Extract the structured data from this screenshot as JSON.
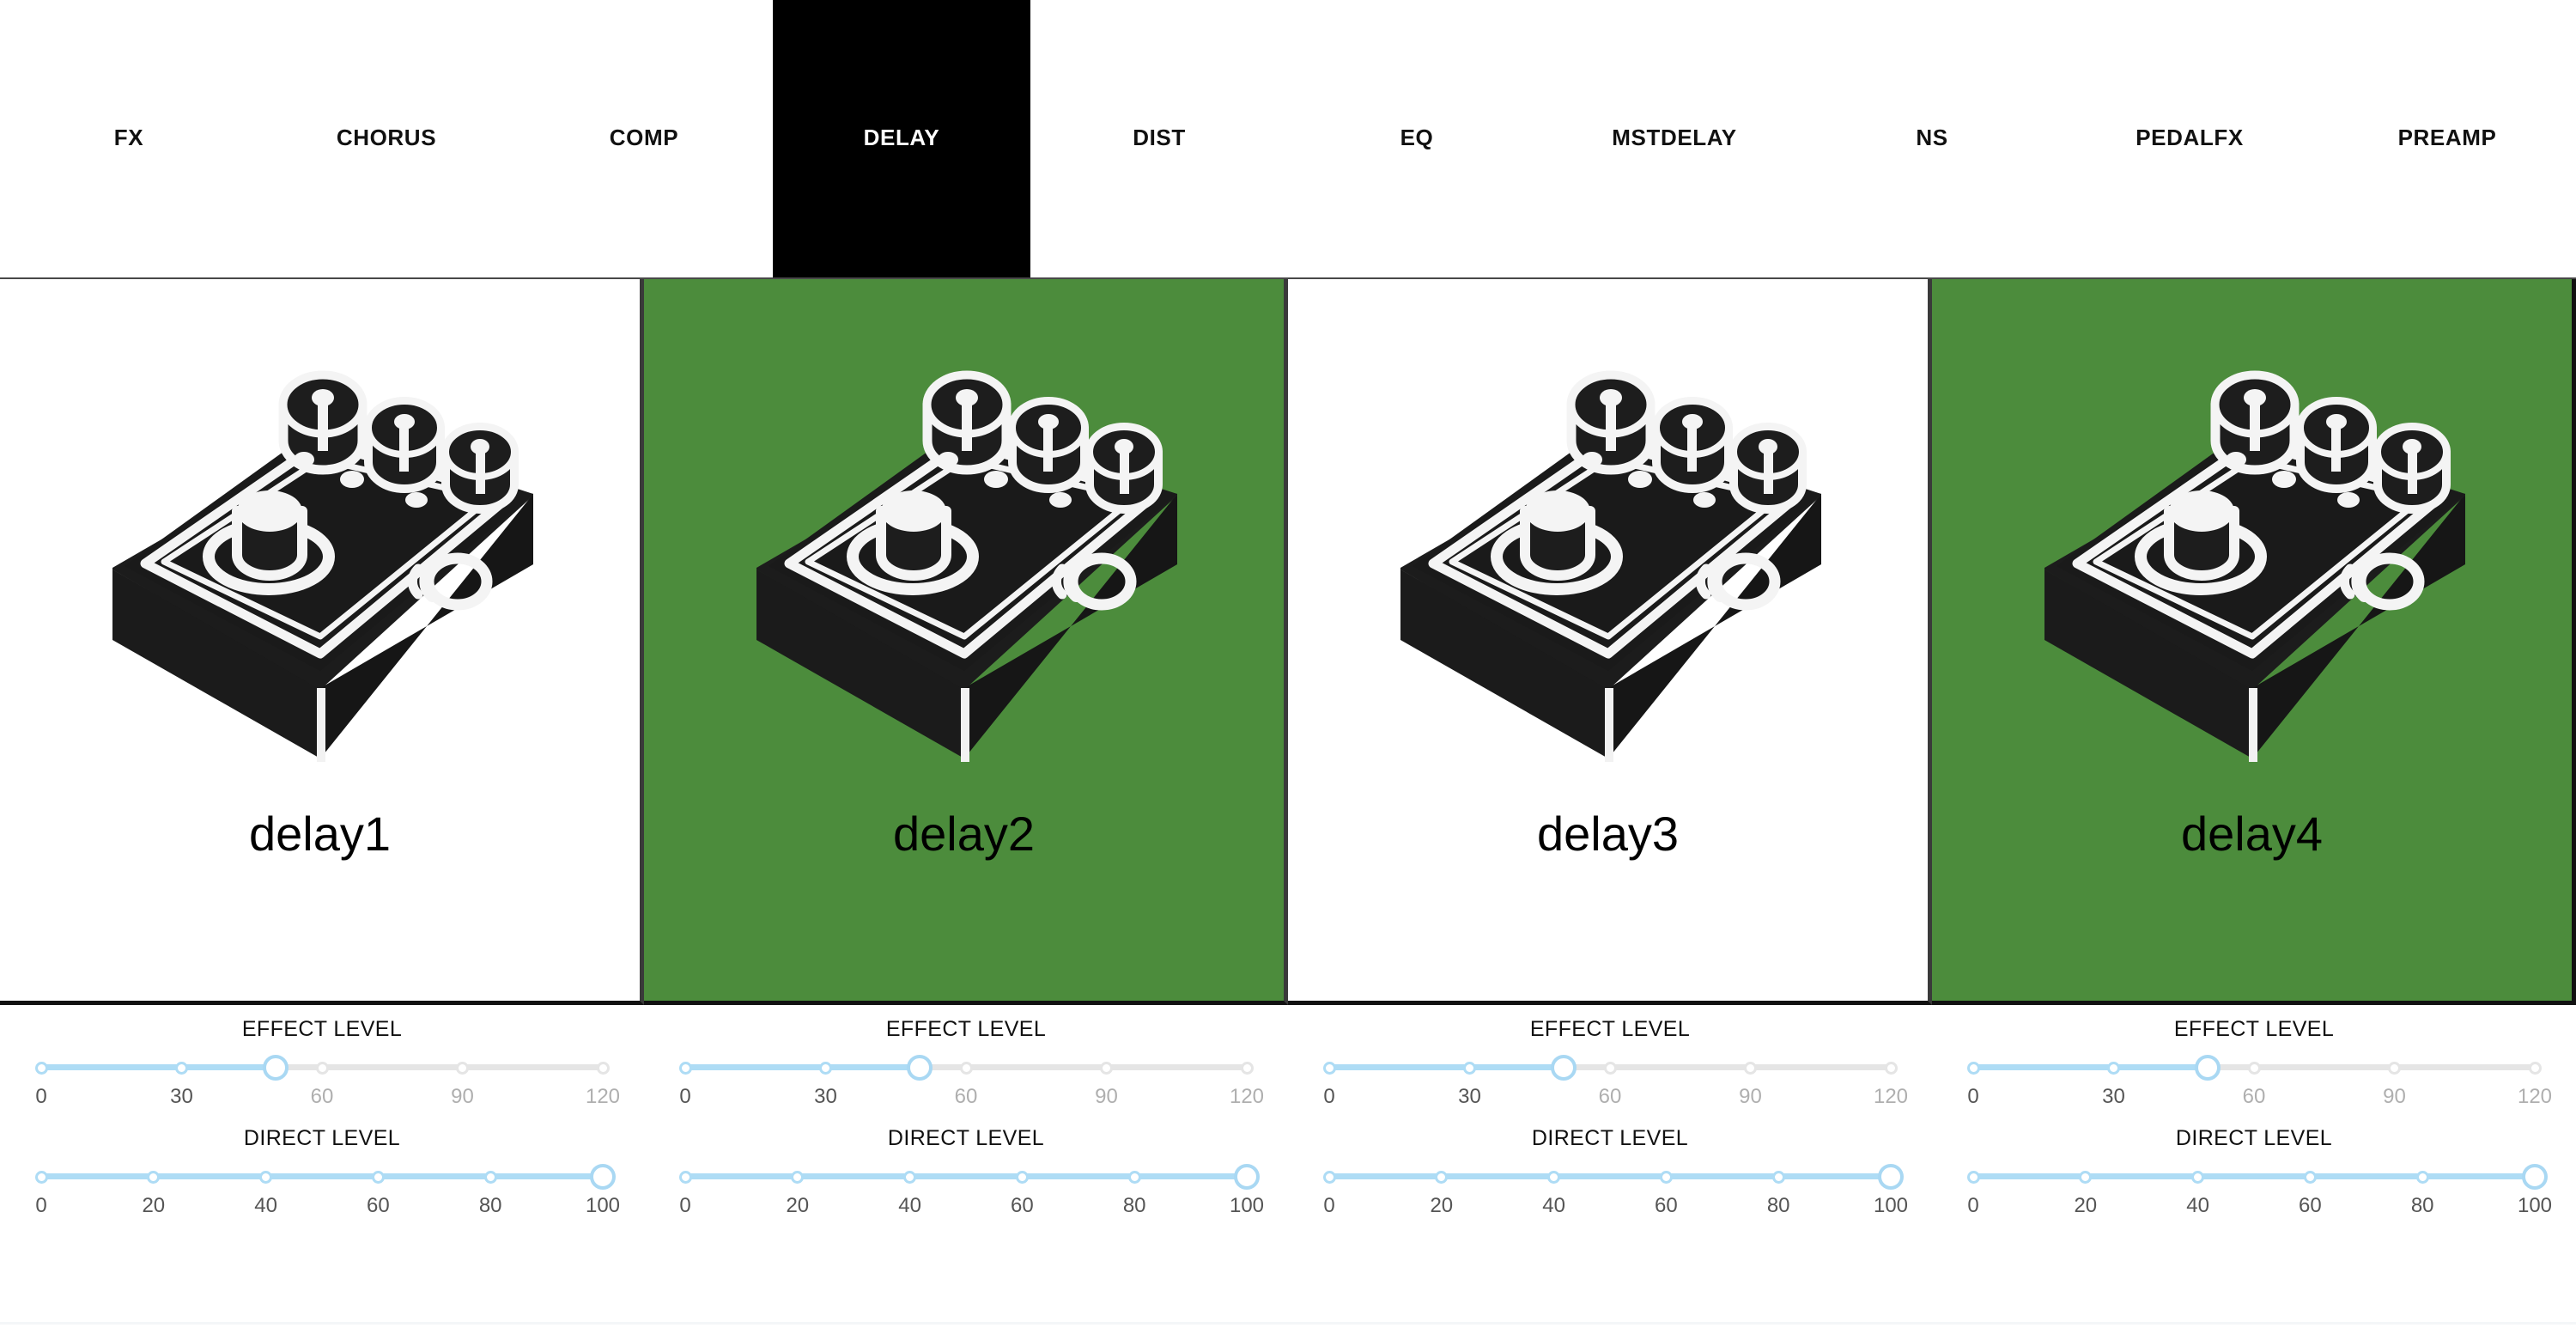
{
  "tabs": [
    {
      "label": "FX",
      "active": false
    },
    {
      "label": "CHORUS",
      "active": false
    },
    {
      "label": "COMP",
      "active": false
    },
    {
      "label": "DELAY",
      "active": true
    },
    {
      "label": "DIST",
      "active": false
    },
    {
      "label": "EQ",
      "active": false
    },
    {
      "label": "MSTDELAY",
      "active": false
    },
    {
      "label": "NS",
      "active": false
    },
    {
      "label": "PEDALFX",
      "active": false
    },
    {
      "label": "PREAMP",
      "active": false
    }
  ],
  "colors": {
    "selected_card_bg": "#4C8C3C",
    "active_tab_bg": "#000000",
    "active_tab_text": "#ffffff",
    "slider_fill": "#AEDCF5",
    "slider_empty": "#E5E5E5",
    "thumb_border": "#A9D8F3"
  },
  "cards": [
    {
      "name": "delay1",
      "icon": "guitar-pedal-icon",
      "selected": false,
      "sliders": [
        {
          "label": "EFFECT LEVEL",
          "min": 0,
          "max": 120,
          "value": 50,
          "step": 30,
          "ticks": [
            "0",
            "30",
            "60",
            "90",
            "120"
          ]
        },
        {
          "label": "DIRECT LEVEL",
          "min": 0,
          "max": 100,
          "value": 100,
          "step": 20,
          "ticks": [
            "0",
            "20",
            "40",
            "60",
            "80",
            "100"
          ]
        }
      ]
    },
    {
      "name": "delay2",
      "icon": "guitar-pedal-icon",
      "selected": true,
      "sliders": [
        {
          "label": "EFFECT LEVEL",
          "min": 0,
          "max": 120,
          "value": 50,
          "step": 30,
          "ticks": [
            "0",
            "30",
            "60",
            "90",
            "120"
          ]
        },
        {
          "label": "DIRECT LEVEL",
          "min": 0,
          "max": 100,
          "value": 100,
          "step": 20,
          "ticks": [
            "0",
            "20",
            "40",
            "60",
            "80",
            "100"
          ]
        }
      ]
    },
    {
      "name": "delay3",
      "icon": "guitar-pedal-icon",
      "selected": false,
      "sliders": [
        {
          "label": "EFFECT LEVEL",
          "min": 0,
          "max": 120,
          "value": 50,
          "step": 30,
          "ticks": [
            "0",
            "30",
            "60",
            "90",
            "120"
          ]
        },
        {
          "label": "DIRECT LEVEL",
          "min": 0,
          "max": 100,
          "value": 100,
          "step": 20,
          "ticks": [
            "0",
            "20",
            "40",
            "60",
            "80",
            "100"
          ]
        }
      ]
    },
    {
      "name": "delay4",
      "icon": "guitar-pedal-icon",
      "selected": true,
      "sliders": [
        {
          "label": "EFFECT LEVEL",
          "min": 0,
          "max": 120,
          "value": 50,
          "step": 30,
          "ticks": [
            "0",
            "30",
            "60",
            "90",
            "120"
          ]
        },
        {
          "label": "DIRECT LEVEL",
          "min": 0,
          "max": 100,
          "value": 100,
          "step": 20,
          "ticks": [
            "0",
            "20",
            "40",
            "60",
            "80",
            "100"
          ]
        }
      ]
    }
  ]
}
